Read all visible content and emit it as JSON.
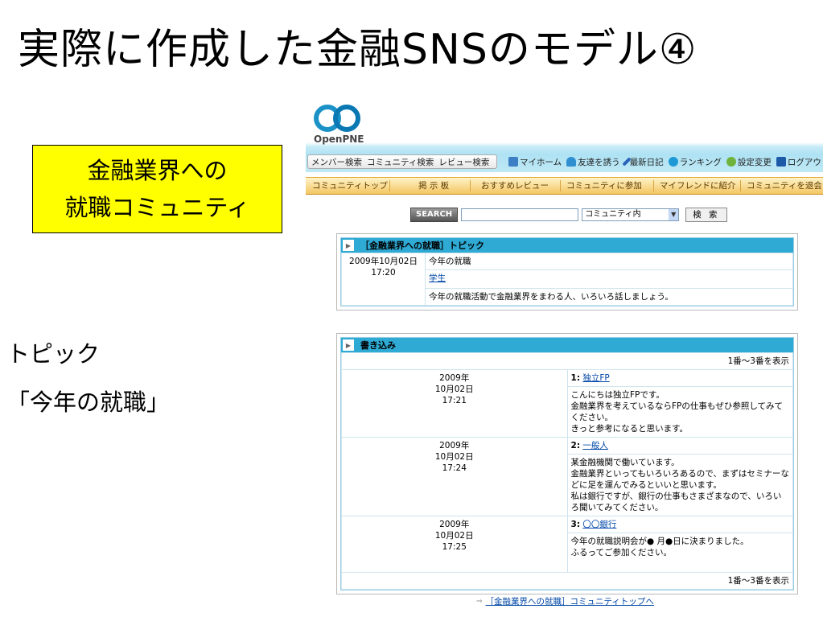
{
  "slide": {
    "title": "実際に作成した金融SNSのモデル④",
    "callout_line1": "金融業界への",
    "callout_line2": "就職コミュニティ",
    "side_label_1": "トピック",
    "side_label_2": "「今年の就職」"
  },
  "logo": {
    "text": "OpenPNE"
  },
  "search_nav": {
    "member_search": "メンバー検索",
    "community_search": "コミュニティ検索",
    "review_search": "レビュー検索"
  },
  "top_nav": [
    {
      "label": "マイホーム",
      "icon": "home-icon",
      "color": "#3c7fc4"
    },
    {
      "label": "友達を誘う",
      "icon": "user-icon",
      "color": "#2f8fd1"
    },
    {
      "label": "最新日記",
      "icon": "pencil-icon",
      "color": "#2a64b8"
    },
    {
      "label": "ランキング",
      "icon": "ranking-icon",
      "color": "#1d9ad6"
    },
    {
      "label": "設定変更",
      "icon": "gear-icon",
      "color": "#6fb33c"
    },
    {
      "label": "ログアウト",
      "icon": "logout-icon",
      "color": "#1d5aa8"
    }
  ],
  "menu": [
    {
      "label": "コミュニティトップ"
    },
    {
      "label": "掲 示 板"
    },
    {
      "label": "おすすめレビュー"
    },
    {
      "label": "コミュニティに参加"
    },
    {
      "label": "マイフレンドに紹介"
    },
    {
      "label": "コミュニティを退会"
    }
  ],
  "search_form": {
    "button": "SEARCH",
    "input_value": "",
    "scope_selected": "コミュニティ内",
    "submit": "検 索"
  },
  "topic_panel": {
    "title": "［金融業界への就職］トピック",
    "date": "2009年10月02日",
    "time": "17:20",
    "topic_title": "今年の就職",
    "author": "学生",
    "body": "今年の就職活動で金融業界をまわる人、いろいろ話しましょう。"
  },
  "comments_panel": {
    "title": "書き込み",
    "range_top": "1番～3番を表示",
    "range_bottom": "1番～3番を表示",
    "comments": [
      {
        "date_line1": "2009年",
        "date_line2": "10月02日",
        "time": "17:21",
        "number": "1",
        "author": "独立FP",
        "body": [
          "こんにちは独立FPです。",
          "金融業界を考えているならFPの仕事もぜひ参照してみてください。",
          "きっと参考になると思います。"
        ]
      },
      {
        "date_line1": "2009年",
        "date_line2": "10月02日",
        "time": "17:24",
        "number": "2",
        "author": "一般人",
        "body": [
          "某金融機関で働いています。",
          "金融業界といってもいろいろあるので、まずはセミナーなどに足を運んでみるといいと思います。",
          "私は銀行ですが、銀行の仕事もさまざまなので、いろいろ聞いてみてください。"
        ]
      },
      {
        "date_line1": "2009年",
        "date_line2": "10月02日",
        "time": "17:25",
        "number": "3",
        "author": "〇〇銀行",
        "body": [
          "今年の就職説明会が● 月●日に決まりました。",
          "ふるってご参加ください。"
        ]
      }
    ]
  },
  "footer_link": "［金融業界への就職］コミュニティトップへ"
}
